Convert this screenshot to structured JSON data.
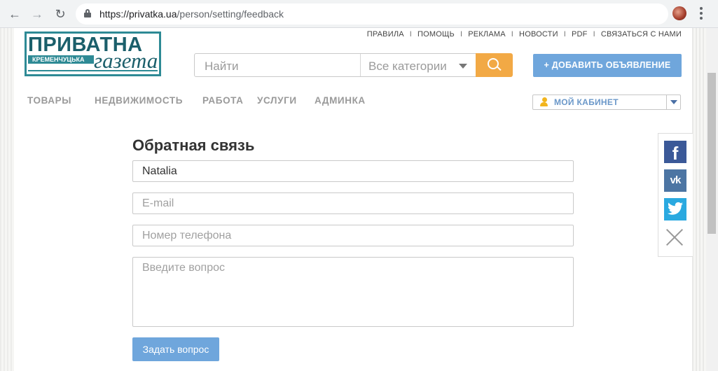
{
  "browser": {
    "url_host": "https://privatka.ua",
    "url_path": "/person/setting/feedback"
  },
  "logo": {
    "line1": "ПРИВАТНА",
    "line2": "КРЕМЕНЧУЦЬКА",
    "line3": "газета"
  },
  "toplinks": [
    "ПРАВИЛА",
    "ПОМОЩЬ",
    "РЕКЛАМА",
    "НОВОСТИ",
    "PDF",
    "СВЯЗАТЬСЯ С НАМИ"
  ],
  "search": {
    "placeholder": "Найти",
    "category": "Все категории"
  },
  "add_button": "+ ДОБАВИТЬ ОБЪЯВЛЕНИЕ",
  "nav": [
    "ТОВАРЫ",
    "НЕДВИЖИМОСТЬ",
    "РАБОТА",
    "УСЛУГИ",
    "АДМИНКА"
  ],
  "cabinet": "МОЙ КАБИНЕТ",
  "form": {
    "title": "Обратная связь",
    "name_value": "Natalia",
    "email_placeholder": "E-mail",
    "phone_placeholder": "Номер телефона",
    "question_placeholder": "Введите вопрос",
    "submit": "Задать вопрос"
  },
  "share": {
    "icons": [
      "facebook-icon",
      "vk-icon",
      "twitter-icon",
      "close-icon"
    ]
  }
}
